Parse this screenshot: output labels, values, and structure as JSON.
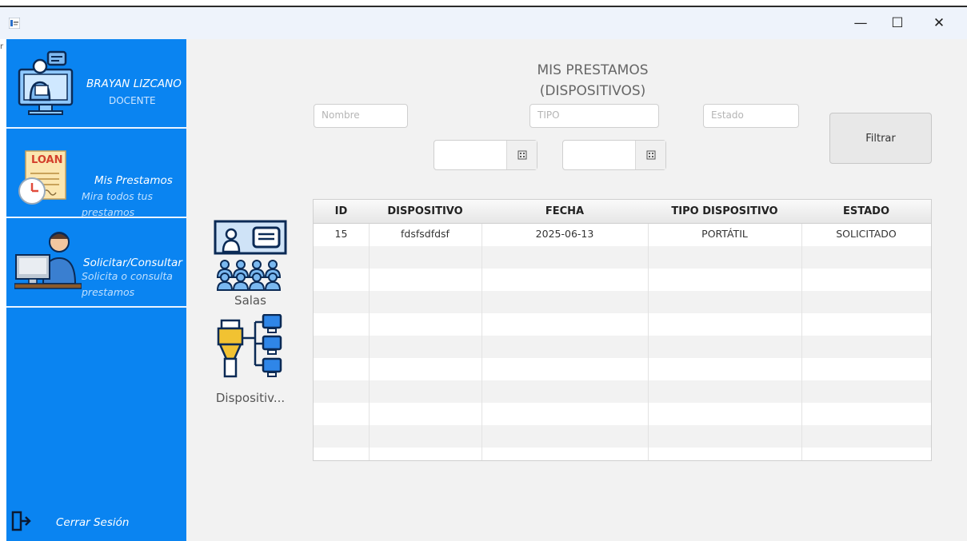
{
  "window": {
    "controls": {
      "minimize": "—",
      "maximize": "☐",
      "close": "✕"
    },
    "edge_char": "r"
  },
  "sidebar": {
    "user": {
      "name": "BRAYAN LIZCANO",
      "role": "DOCENTE"
    },
    "items": [
      {
        "title": "Mis Prestamos",
        "subtitle_line1": "Mira todos tus",
        "subtitle_line2": "prestamos",
        "icon": "loan-icon",
        "icon_label": "LOAN"
      },
      {
        "title": "Solicitar/Consultar",
        "subtitle_line1": "Solicita o consulta",
        "subtitle_line2": "prestamos",
        "icon": "person-computer-icon"
      }
    ],
    "logout": {
      "label": "Cerrar Sesión",
      "icon": "logout-icon"
    },
    "colors": {
      "background": "#0a84f1",
      "separator": "#eaf4ff"
    }
  },
  "main": {
    "heading_line1": "MIS PRESTAMOS",
    "heading_line2": "(DISPOSITIVOS)",
    "filters": {
      "nombre_placeholder": "Nombre",
      "tipo_placeholder": "TIPO",
      "estado_placeholder": "Estado",
      "filter_button": "Filtrar"
    },
    "categories": [
      {
        "label": "Salas",
        "icon": "rooms-icon"
      },
      {
        "label": "Dispositiv...",
        "icon": "devices-icon"
      }
    ],
    "table": {
      "columns": [
        "ID",
        "DISPOSITIVO",
        "FECHA",
        "TIPO DISPOSITIVO",
        "ESTADO"
      ],
      "rows": [
        {
          "id": "15",
          "dispositivo": "fdsfsdfdsf",
          "fecha": "2025-06-13",
          "tipo": "PORTÁTIL",
          "estado": "SOLICITADO"
        }
      ]
    }
  }
}
